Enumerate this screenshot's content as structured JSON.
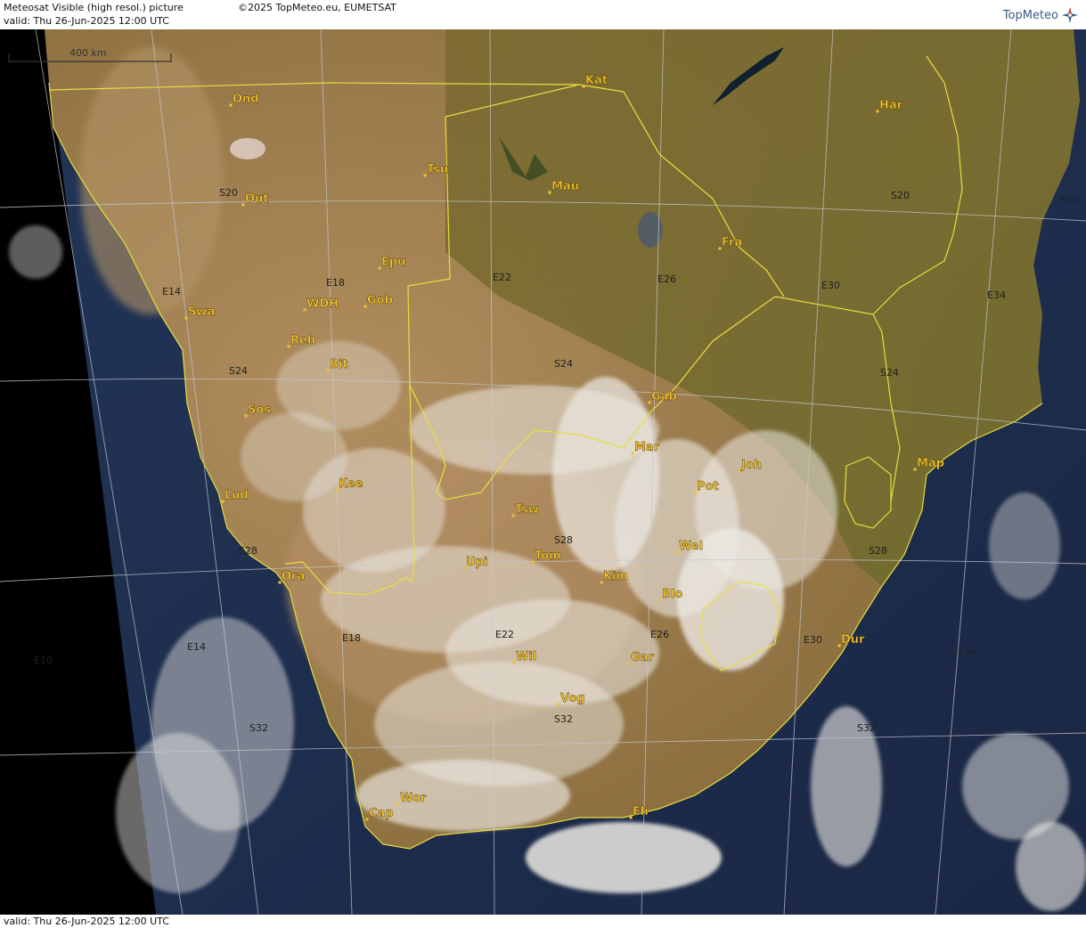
{
  "header": {
    "product": "Meteosat Visible (high resol.) picture",
    "valid": "valid:  Thu  26-Jun-2025  12:00 UTC",
    "copyright": "©2025 TopMeteo.eu, EUMETSAT",
    "logo": "TopMeteo"
  },
  "footer": {
    "valid": "valid:  Thu  26-Jun-2025  12:00 UTC"
  },
  "scale": {
    "label": "400 km"
  },
  "cities": [
    {
      "code": "Ond"
    },
    {
      "code": "Kat"
    },
    {
      "code": "Har"
    },
    {
      "code": "Tsu"
    },
    {
      "code": "Out"
    },
    {
      "code": "Mau"
    },
    {
      "code": "Fra"
    },
    {
      "code": "Epu"
    },
    {
      "code": "Gob"
    },
    {
      "code": "WDH"
    },
    {
      "code": "Swa"
    },
    {
      "code": "Reh"
    },
    {
      "code": "Bit"
    },
    {
      "code": "Sos"
    },
    {
      "code": "Gab"
    },
    {
      "code": "Mar"
    },
    {
      "code": "Joh"
    },
    {
      "code": "Map"
    },
    {
      "code": "Kee"
    },
    {
      "code": "Pot"
    },
    {
      "code": "Lud"
    },
    {
      "code": "Tsw"
    },
    {
      "code": "Wel"
    },
    {
      "code": "Upi"
    },
    {
      "code": "Tom"
    },
    {
      "code": "Kim"
    },
    {
      "code": "Ora"
    },
    {
      "code": "Blo"
    },
    {
      "code": "Dur"
    },
    {
      "code": "Wil"
    },
    {
      "code": "Gar"
    },
    {
      "code": "Vog"
    },
    {
      "code": "Wor"
    },
    {
      "code": "Cap"
    },
    {
      "code": "Eli"
    }
  ],
  "grid_labels": [
    {
      "text": "S20"
    },
    {
      "text": "S20"
    },
    {
      "text": "S20"
    },
    {
      "text": "S24"
    },
    {
      "text": "S24"
    },
    {
      "text": "S24"
    },
    {
      "text": "S28"
    },
    {
      "text": "S28"
    },
    {
      "text": "S28"
    },
    {
      "text": "S32"
    },
    {
      "text": "S32"
    },
    {
      "text": "S32"
    },
    {
      "text": "E10"
    },
    {
      "text": "E14"
    },
    {
      "text": "E14"
    },
    {
      "text": "E18"
    },
    {
      "text": "E18"
    },
    {
      "text": "E22"
    },
    {
      "text": "E22"
    },
    {
      "text": "E26"
    },
    {
      "text": "E26"
    },
    {
      "text": "E30"
    },
    {
      "text": "E30"
    },
    {
      "text": "E34"
    },
    {
      "text": "E34"
    }
  ],
  "colors": {
    "land": "#8a6e3c",
    "land_dark": "#6f5a2e",
    "desert": "#a8865a",
    "ocean": "#1d2c48",
    "space": "#000000",
    "border": "#e8e040",
    "grid": "#b8bcc6",
    "label": "#f2c230",
    "cloud": "#e8e6e2"
  }
}
